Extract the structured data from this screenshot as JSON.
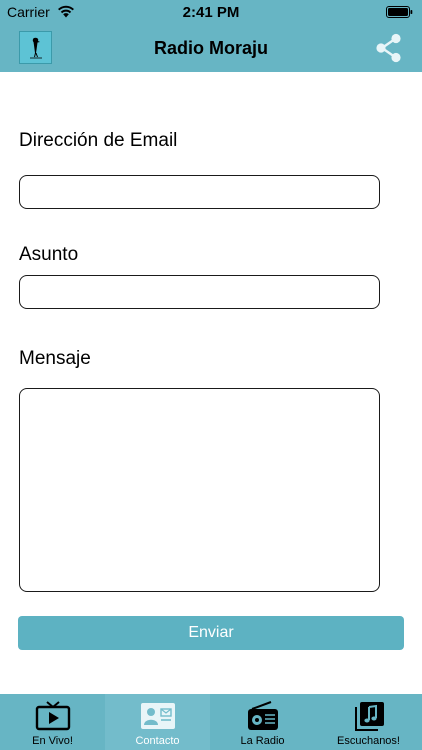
{
  "status_bar": {
    "carrier": "Carrier",
    "time": "2:41 PM"
  },
  "navbar": {
    "title": "Radio Moraju",
    "logo_icon": "bird-logo-icon",
    "share_icon": "share-icon"
  },
  "form": {
    "email_label": "Dirección de Email",
    "email_value": "",
    "subject_label": "Asunto",
    "subject_value": "",
    "message_label": "Mensaje",
    "message_value": "",
    "submit_label": "Enviar"
  },
  "tabs": [
    {
      "label": "En Vivo!",
      "icon": "tv-icon",
      "active": false
    },
    {
      "label": "Contacto",
      "icon": "contact-card-icon",
      "active": true
    },
    {
      "label": "La Radio",
      "icon": "radio-icon",
      "active": false
    },
    {
      "label": "Escuchanos!",
      "icon": "music-note-icon",
      "active": false
    }
  ],
  "colors": {
    "bar": "#67b5c4",
    "button": "#5db2c2",
    "active_tab": "#73bccb"
  }
}
